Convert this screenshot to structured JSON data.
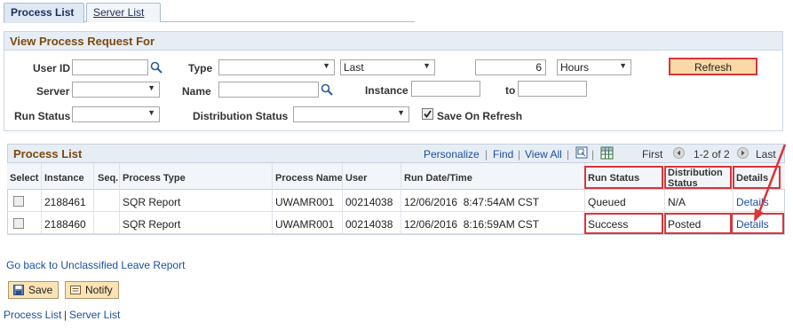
{
  "tabs": {
    "process_list": "Process List",
    "server_list": "Server List"
  },
  "filters": {
    "heading": "View Process Request For",
    "user_id_label": "User ID",
    "user_id_value": "",
    "type_label": "Type",
    "type_value": "",
    "range_value": "Last",
    "amount_value": "6",
    "unit_value": "Hours",
    "refresh_label": "Refresh",
    "server_label": "Server",
    "server_value": "",
    "name_label": "Name",
    "name_value": "",
    "instance_label": "Instance",
    "instance_from": "",
    "to_label": "to",
    "instance_to": "",
    "run_status_label": "Run Status",
    "run_status_value": "",
    "dist_status_label": "Distribution Status",
    "dist_status_value": "",
    "save_on_refresh_label": "Save On Refresh",
    "save_on_refresh_checked": true
  },
  "grid": {
    "title": "Process List",
    "personalize": "Personalize",
    "find": "Find",
    "view_all": "View All",
    "first": "First",
    "range": "1-2 of 2",
    "last": "Last",
    "columns": {
      "select": "Select",
      "instance": "Instance",
      "seq": "Seq.",
      "process_type": "Process Type",
      "process_name": "Process Name",
      "user": "User",
      "run_datetime": "Run Date/Time",
      "run_status": "Run Status",
      "dist_status_1": "Distribution",
      "dist_status_2": "Status",
      "details": "Details"
    },
    "rows": [
      {
        "instance": "2188461",
        "seq": "",
        "process_type": "SQR Report",
        "process_name": "UWAMR001",
        "user": "00214038",
        "run_datetime": "12/06/2016  8:47:54AM CST",
        "run_status": "Queued",
        "dist_status": "N/A",
        "details": "Details"
      },
      {
        "instance": "2188460",
        "seq": "",
        "process_type": "SQR Report",
        "process_name": "UWAMR001",
        "user": "00214038",
        "run_datetime": "12/06/2016  8:16:59AM CST",
        "run_status": "Success",
        "dist_status": "Posted",
        "details": "Details"
      }
    ]
  },
  "footer": {
    "go_back": "Go back to Unclassified Leave Report",
    "save": "Save",
    "notify": "Notify",
    "process_list": "Process List",
    "separator": "|",
    "server_list": "Server List"
  },
  "colors": {
    "highlight": "#d9353a",
    "button": "#fbd9a6",
    "header_text": "#7a4a10",
    "link": "#1b4f9c"
  },
  "icons": [
    "lookup-icon",
    "dropdown-arrow-icon",
    "checkbox-icon",
    "zoom-icon",
    "download-grid-icon",
    "first-page-icon",
    "last-page-icon",
    "save-icon",
    "notify-icon",
    "annotation-arrow"
  ]
}
